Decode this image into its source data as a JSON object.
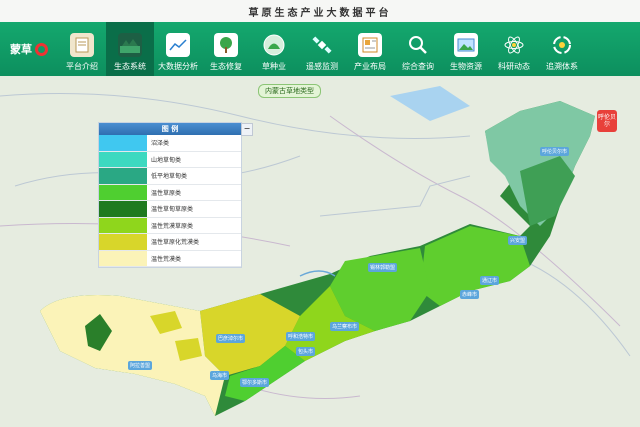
{
  "app": {
    "title": "草原生态产业大数据平台",
    "logo_text": "蒙草"
  },
  "nav": {
    "items": [
      {
        "label": "平台介绍",
        "icon": "document-icon"
      },
      {
        "label": "生态系统",
        "icon": "landscape-icon",
        "active": true
      },
      {
        "label": "大数据分析",
        "icon": "line-chart-icon"
      },
      {
        "label": "生态修复",
        "icon": "tree-icon"
      },
      {
        "label": "草种业",
        "icon": "seed-icon"
      },
      {
        "label": "遥感监测",
        "icon": "satellite-icon"
      },
      {
        "label": "产业布局",
        "icon": "layout-icon"
      },
      {
        "label": "综合查询",
        "icon": "search-icon"
      },
      {
        "label": "生物资源",
        "icon": "image-icon"
      },
      {
        "label": "科研动态",
        "icon": "atom-icon"
      },
      {
        "label": "追溯体系",
        "icon": "trace-icon"
      }
    ]
  },
  "map": {
    "banner": "内蒙古草地类型",
    "badge": "呼伦贝尔",
    "cities": [
      "呼伦贝尔市",
      "兴安盟",
      "锡林郭勒盟",
      "通辽市",
      "赤峰市",
      "乌兰察布市",
      "呼和浩特市",
      "包头市",
      "巴彦淖尔市",
      "鄂尔多斯市",
      "乌海市",
      "阿拉善盟"
    ]
  },
  "legend": {
    "title": "图 例",
    "minimize": "−",
    "items": [
      {
        "label": "沼泽类",
        "color": "#40c8f0"
      },
      {
        "label": "山地草甸类",
        "color": "#3cd9c0"
      },
      {
        "label": "低平地草甸类",
        "color": "#2aa884"
      },
      {
        "label": "温性草原类",
        "color": "#4fcf30"
      },
      {
        "label": "温性草甸草原类",
        "color": "#1f7a1f"
      },
      {
        "label": "温性荒漠草原类",
        "color": "#8fd61c"
      },
      {
        "label": "温性草原化荒漠类",
        "color": "#d8d62a"
      },
      {
        "label": "温性荒漠类",
        "color": "#fbf3b8"
      }
    ]
  },
  "colors": {
    "nav_bg": "#14a86e",
    "nav_active": "#0a6e49"
  }
}
